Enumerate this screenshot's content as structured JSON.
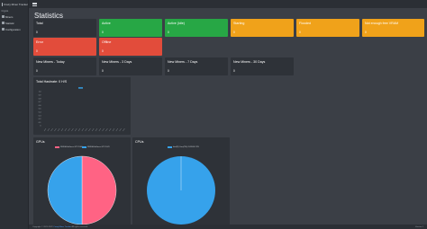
{
  "app": {
    "brand": "Crazy Miner Tracker"
  },
  "sidebar": {
    "header": "Crypto",
    "items": [
      {
        "label": "Miners"
      },
      {
        "label": "Statistic"
      },
      {
        "label": "Configuration"
      }
    ]
  },
  "page": {
    "title": "Statistics"
  },
  "cards": {
    "total": {
      "title": "Total",
      "value": "0"
    },
    "active": {
      "title": "Active",
      "value": "0"
    },
    "active_idle": {
      "title": "Active (Idle)",
      "value": "0"
    },
    "starting": {
      "title": "Starting",
      "value": "0"
    },
    "flooded": {
      "title": "Flooded",
      "value": "0"
    },
    "not_enough_vram": {
      "title": "Not enough free VRAM",
      "value": "0"
    },
    "error": {
      "title": "Error",
      "value": "0"
    },
    "offline": {
      "title": "Offline",
      "value": "0"
    },
    "new_today": {
      "title": "New Miners - Today",
      "value": "0"
    },
    "new_3d": {
      "title": "New Miners - 3 Days",
      "value": "0"
    },
    "new_7d": {
      "title": "New Miners - 7 Days",
      "value": "0"
    },
    "new_30d": {
      "title": "New Miners - 30 Days",
      "value": "0"
    }
  },
  "colors": {
    "green": "#27a745",
    "orange": "#f0a21a",
    "red": "#e24c3b",
    "dark_card": "#2e3238",
    "pie_pink": "#ff6384",
    "pie_blue": "#36a2eb"
  },
  "chart_data": [
    {
      "type": "line",
      "title": "Total Hashrate: 0 H/S",
      "series": [
        {
          "name": "",
          "values": []
        }
      ],
      "ylim": [
        0,
        1
      ],
      "y_ticks": [
        "1.0",
        "0.9",
        "0.8",
        "0.7",
        "0.6",
        "0.5",
        "0.4",
        "0.3",
        "0.2",
        "0.1",
        "0"
      ],
      "grid": false
    },
    {
      "type": "pie",
      "title": "GPUs",
      "slices": [
        {
          "label": "NVIDIA GeForce GTX 1060",
          "value": 50,
          "color": "#ff6384"
        },
        {
          "label": "NVIDIA GeForce GTX 1070",
          "value": 50,
          "color": "#36a2eb"
        }
      ]
    },
    {
      "type": "pie",
      "title": "CPUs",
      "slices": [
        {
          "label": "Intel(R) Core(TM) i7-8700K CPU",
          "value": 100,
          "color": "#36a2eb"
        }
      ]
    }
  ],
  "footer": {
    "left": "Copyright © 2021-2022",
    "link": "Crazy Miner Tracker",
    "rights": "All rights reserved.",
    "right": "Version 1"
  }
}
